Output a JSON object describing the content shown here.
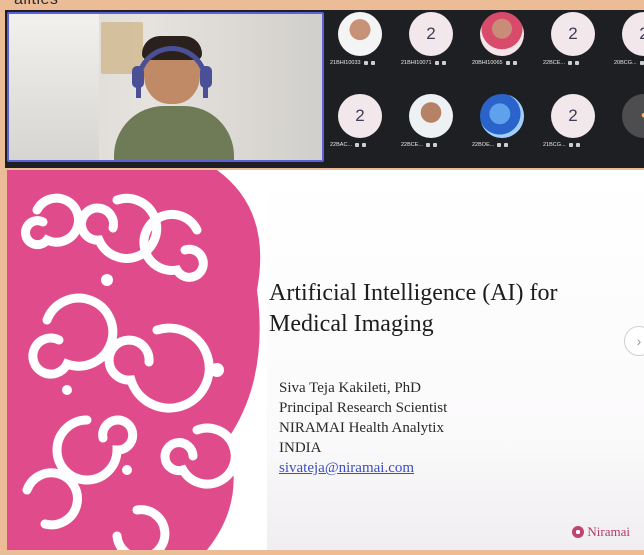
{
  "header_cutoff": "alities",
  "speaker": {
    "name": ""
  },
  "participants": [
    {
      "label": "21BHI10033",
      "avatar": "photo1",
      "initial": ""
    },
    {
      "label": "21BHI10071",
      "avatar": "num",
      "initial": "2"
    },
    {
      "label": "20BHI10065",
      "avatar": "photo2",
      "initial": ""
    },
    {
      "label": "22BCE...",
      "avatar": "num",
      "initial": "2"
    },
    {
      "label": "20BCG...",
      "avatar": "num",
      "initial": "2"
    },
    {
      "label": "22BAC...",
      "avatar": "num",
      "initial": "2"
    },
    {
      "label": "22BCE...",
      "avatar": "photo3",
      "initial": ""
    },
    {
      "label": "22BOE...",
      "avatar": "photo4",
      "initial": ""
    },
    {
      "label": "21BCG...",
      "avatar": "num",
      "initial": "2"
    },
    {
      "label": "",
      "avatar": "photo5",
      "initial": "•"
    }
  ],
  "slide": {
    "title_line1": "Artificial Intelligence (AI) for",
    "title_line2": "Medical Imaging",
    "presenter_name": "Siva Teja Kakileti, PhD",
    "presenter_role": "Principal Research Scientist",
    "presenter_org": "NIRAMAI Health Analytix",
    "presenter_country": "INDIA",
    "presenter_email": "sivateja@niramai.com",
    "logo_text": "Niramai",
    "accent_color": "#e04b8c"
  },
  "colors": {
    "frame_bg": "#ecbc96",
    "strip_bg": "#1e1f22",
    "active_speaker_border": "#5b61d6"
  }
}
